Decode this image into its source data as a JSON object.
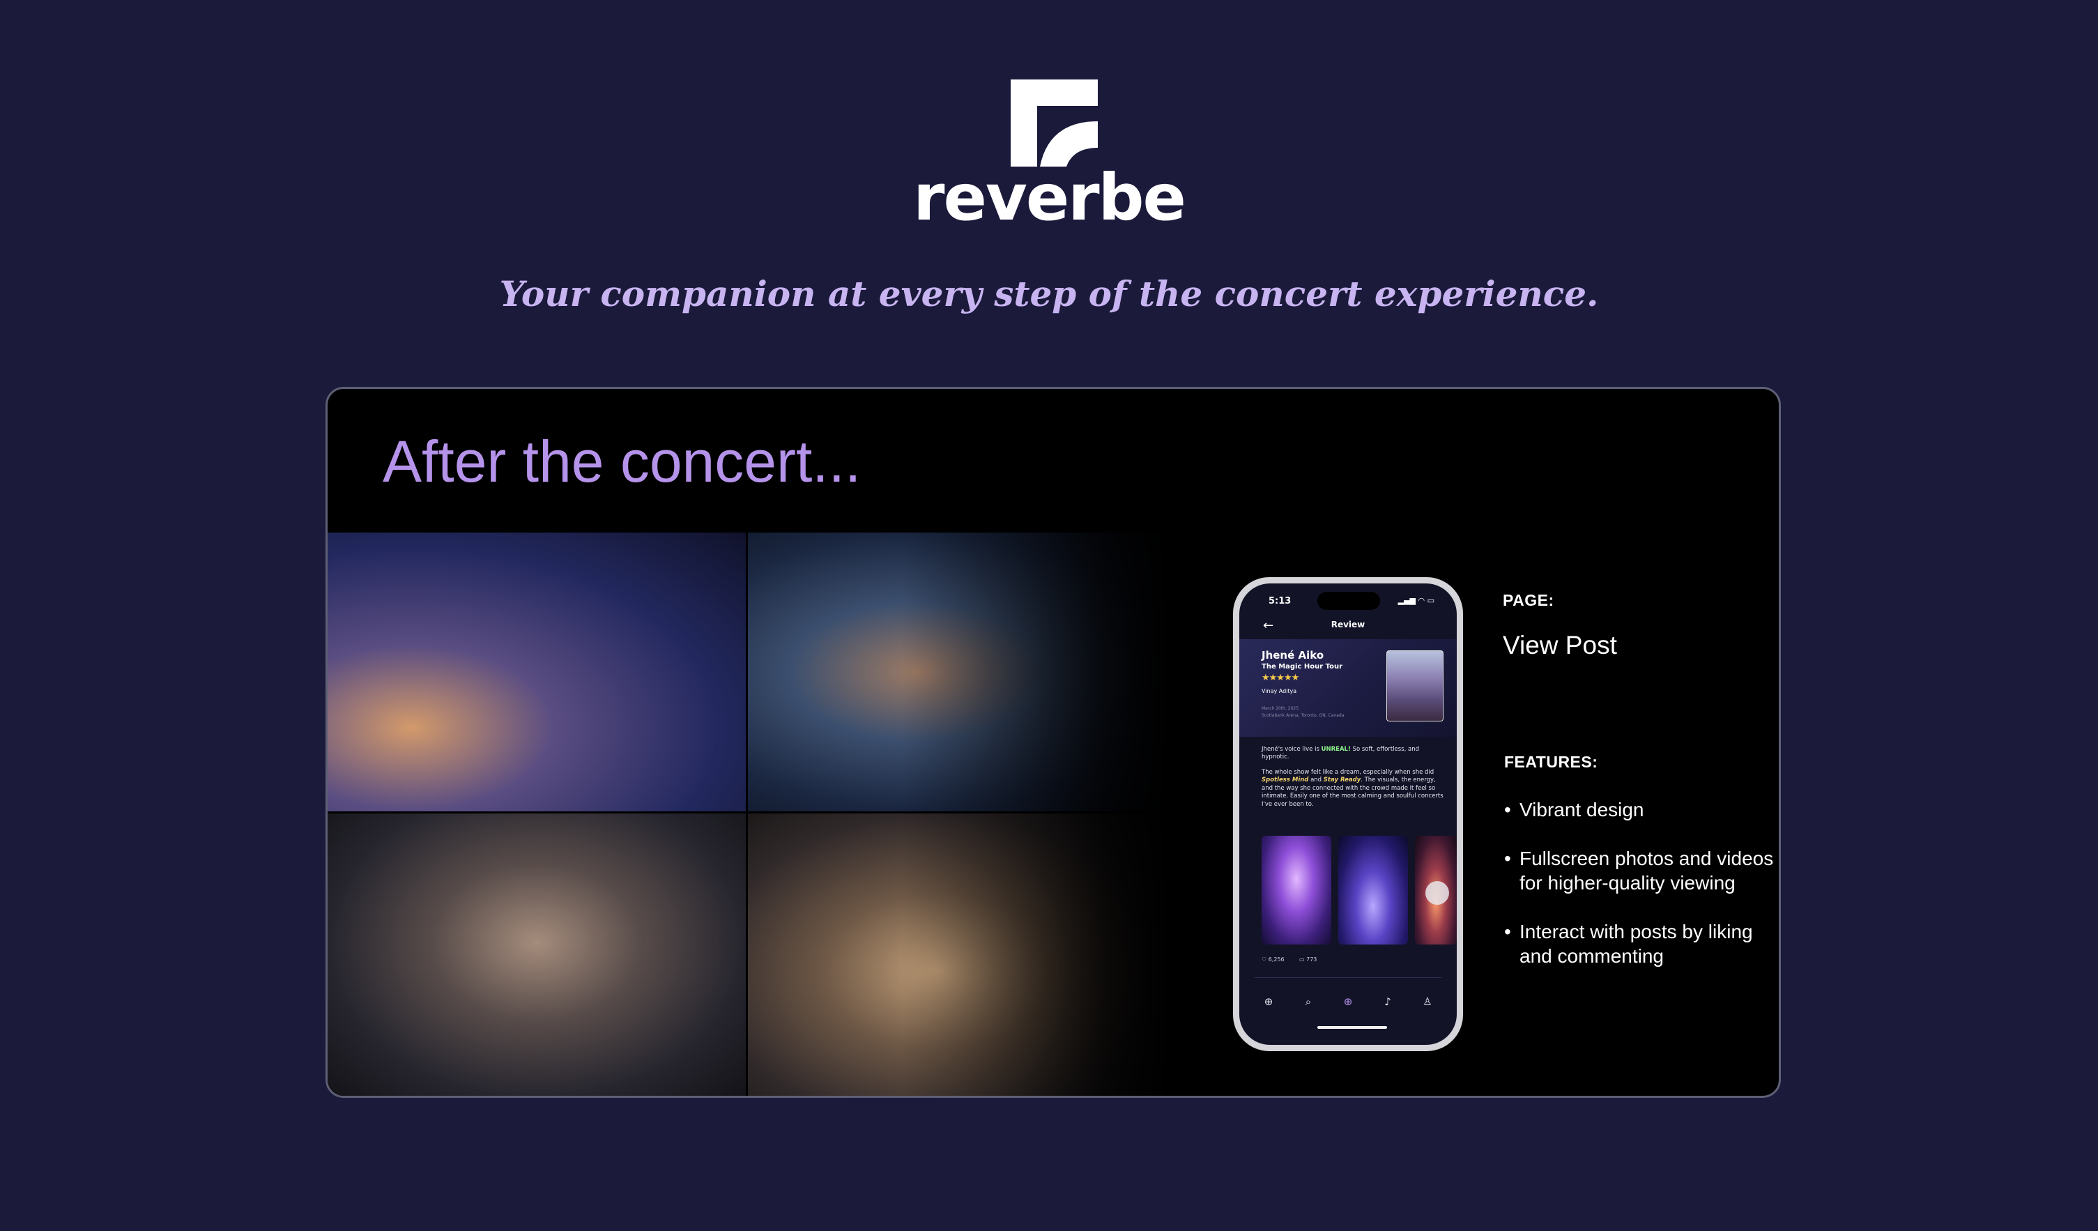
{
  "brand": {
    "name": "reverbe",
    "tagline": "Your companion at every step of the concert experience."
  },
  "card": {
    "title": "After the concert...",
    "photos": [
      {
        "caption": ""
      },
      {
        "caption": ""
      },
      {
        "caption": ""
      },
      {
        "caption": ""
      }
    ]
  },
  "phone": {
    "status_time": "5:13",
    "status_icons": "▂▄▆ ◠ ▭",
    "nav_title": "Review",
    "artist": "Jhené Aiko",
    "tour": "The Magic Hour Tour",
    "rating_stars": "★★★★★",
    "author": "Vinay Aditya",
    "meta_date": "March 20th, 2025",
    "meta_venue": "Scotiabank Arena, Toronto, ON, Canada",
    "review_p1_a": "Jhené's voice live is ",
    "review_p1_hl": "UNREAL!",
    "review_p1_b": " So soft, effortless, and hypnotic.",
    "review_p2_a": "The whole show felt like a dream, especially when she did ",
    "review_p2_hl1": "Spotless Mind",
    "review_p2_mid": " and ",
    "review_p2_hl2": "Stay Ready",
    "review_p2_b": ". The visuals, the energy, and the way she connected with the crowd made it feel so intimate. Easily one of the most calming and soulful concerts I've ever been to.",
    "likes": "♡ 6,256",
    "comments": "▭ 773",
    "tabs": [
      {
        "icon": "⊕",
        "name": "globe-icon"
      },
      {
        "icon": "⌕",
        "name": "search-icon"
      },
      {
        "icon": "⊕",
        "name": "add-icon"
      },
      {
        "icon": "♪",
        "name": "bell-icon"
      },
      {
        "icon": "♙",
        "name": "profile-icon"
      }
    ]
  },
  "side": {
    "page_label": "PAGE:",
    "page_name": "View Post",
    "features_label": "FEATURES:",
    "features": [
      "Vibrant design",
      "Fullscreen photos and videos for higher-quality viewing",
      "Interact with posts by liking and commenting"
    ]
  },
  "colors": {
    "background": "#1b1a3b",
    "accent": "#b593ea",
    "tagline": "#c7b4f0"
  }
}
